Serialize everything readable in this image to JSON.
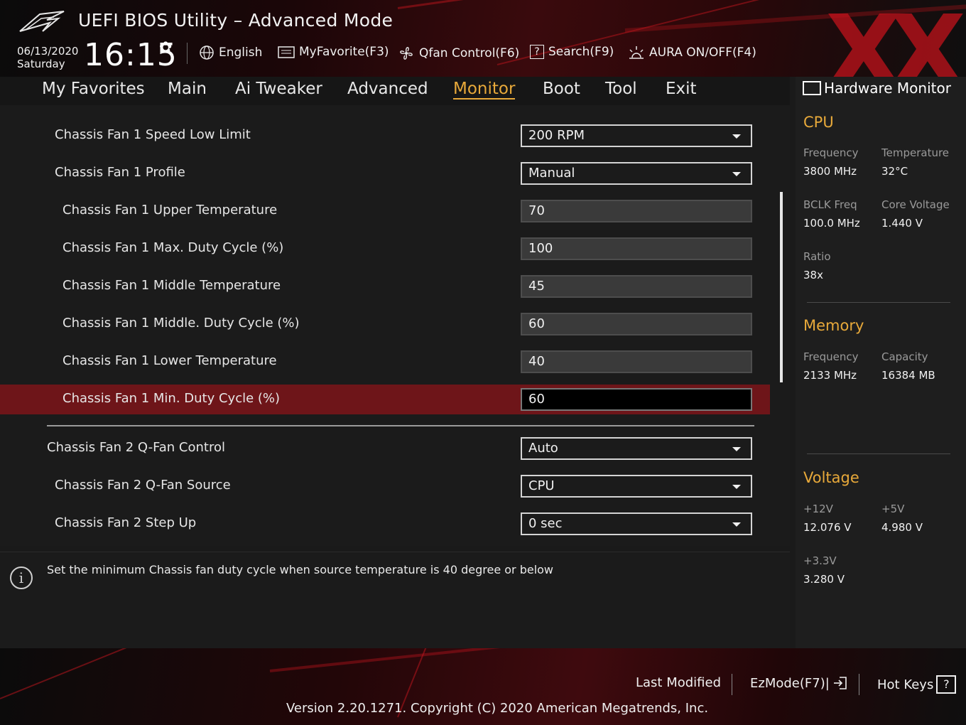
{
  "header": {
    "title": "UEFI BIOS Utility – Advanced Mode",
    "date": "06/13/2020",
    "day": "Saturday",
    "time": "16:15",
    "items": [
      {
        "label": "English",
        "icon": "globe-icon"
      },
      {
        "label": "MyFavorite(F3)",
        "icon": "favorite-list-icon"
      },
      {
        "label": "Qfan Control(F6)",
        "icon": "fan-icon"
      },
      {
        "label": "Search(F9)",
        "icon": "search-box-icon"
      },
      {
        "label": "AURA ON/OFF(F4)",
        "icon": "aura-icon"
      }
    ]
  },
  "nav": {
    "tabs": [
      "My Favorites",
      "Main",
      "Ai Tweaker",
      "Advanced",
      "Monitor",
      "Boot",
      "Tool",
      "Exit"
    ],
    "active": "Monitor"
  },
  "settings": [
    {
      "label": "Chassis Fan 1 Speed Low Limit",
      "value": "200 RPM",
      "type": "dropdown"
    },
    {
      "label": "Chassis Fan 1 Profile",
      "value": "Manual",
      "type": "dropdown"
    },
    {
      "label": "Chassis Fan 1 Upper Temperature",
      "value": "70",
      "type": "input"
    },
    {
      "label": "Chassis Fan 1 Max. Duty Cycle (%)",
      "value": "100",
      "type": "input"
    },
    {
      "label": "Chassis Fan 1 Middle Temperature",
      "value": "45",
      "type": "input"
    },
    {
      "label": "Chassis Fan 1 Middle. Duty Cycle (%)",
      "value": "60",
      "type": "input"
    },
    {
      "label": "Chassis Fan 1 Lower Temperature",
      "value": "40",
      "type": "input"
    },
    {
      "label": "Chassis Fan 1 Min. Duty Cycle (%)",
      "value": "60",
      "type": "input",
      "selected": true
    },
    {
      "label": "Chassis Fan 2 Q-Fan Control",
      "value": "Auto",
      "type": "dropdown"
    },
    {
      "label": "Chassis Fan 2 Q-Fan Source",
      "value": "CPU",
      "type": "dropdown"
    },
    {
      "label": "Chassis Fan 2 Step Up",
      "value": "0 sec",
      "type": "dropdown"
    }
  ],
  "help": {
    "text": "Set the minimum Chassis fan duty cycle when source temperature is 40 degree or below"
  },
  "hardware_monitor": {
    "title": "Hardware Monitor",
    "cpu": {
      "heading": "CPU",
      "frequency_label": "Frequency",
      "frequency": "3800 MHz",
      "temperature_label": "Temperature",
      "temperature": "32°C",
      "bclk_label": "BCLK Freq",
      "bclk": "100.0 MHz",
      "core_voltage_label": "Core Voltage",
      "core_voltage": "1.440 V",
      "ratio_label": "Ratio",
      "ratio": "38x"
    },
    "memory": {
      "heading": "Memory",
      "frequency_label": "Frequency",
      "frequency": "2133 MHz",
      "capacity_label": "Capacity",
      "capacity": "16384 MB"
    },
    "voltage": {
      "heading": "Voltage",
      "v12_label": "+12V",
      "v12": "12.076 V",
      "v5_label": "+5V",
      "v5": "4.980 V",
      "v33_label": "+3.3V",
      "v33": "3.280 V"
    }
  },
  "footer": {
    "last_modified": "Last Modified",
    "ezmode": "EzMode(F7)|",
    "hotkeys": "Hot Keys",
    "hotkeys_icon": "?",
    "version": "Version 2.20.1271. Copyright (C) 2020 American Megatrends, Inc."
  },
  "watermark": "XX",
  "colors": {
    "accent": "#e8a93a",
    "highlight_row": "#6e1519",
    "brand_red": "#c1121b"
  }
}
